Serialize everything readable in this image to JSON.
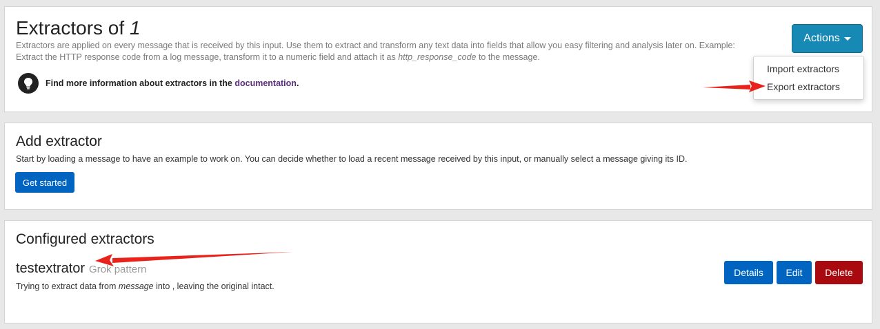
{
  "header": {
    "title_prefix": "Extractors of ",
    "title_input": "1",
    "description_part1": "Extractors are applied on every message that is received by this input. Use them to extract and transform any text data into fields that allow you easy filtering and analysis later on. Example: Extract the HTTP response code from a log message, transform it to a numeric field and attach it as ",
    "description_field": "http_response_code",
    "description_part2": " to the message.",
    "info_text": "Find more information about extractors in the ",
    "info_link": "documentation",
    "info_suffix": "."
  },
  "actions": {
    "label": "Actions",
    "menu": [
      "Import extractors",
      "Export extractors"
    ]
  },
  "add_extractor": {
    "title": "Add extractor",
    "description": "Start by loading a message to have an example to work on. You can decide whether to load a recent message received by this input, or manually select a message giving its ID.",
    "button": "Get started"
  },
  "configured": {
    "title": "Configured extractors",
    "items": [
      {
        "name": "testextrator",
        "type": "Grok pattern",
        "desc_prefix": "Trying to extract data from ",
        "desc_field": "message",
        "desc_suffix": " into , leaving the original intact.",
        "buttons": {
          "details": "Details",
          "edit": "Edit",
          "delete": "Delete"
        }
      }
    ]
  },
  "colors": {
    "primary": "#0064c0",
    "info": "#1689b5",
    "danger": "#a90a0f",
    "annotation_arrow": "#e8231c",
    "link": "#5a2c7d"
  },
  "icons": {
    "info": "lightbulb-icon",
    "caret": "chevron-down-icon"
  }
}
